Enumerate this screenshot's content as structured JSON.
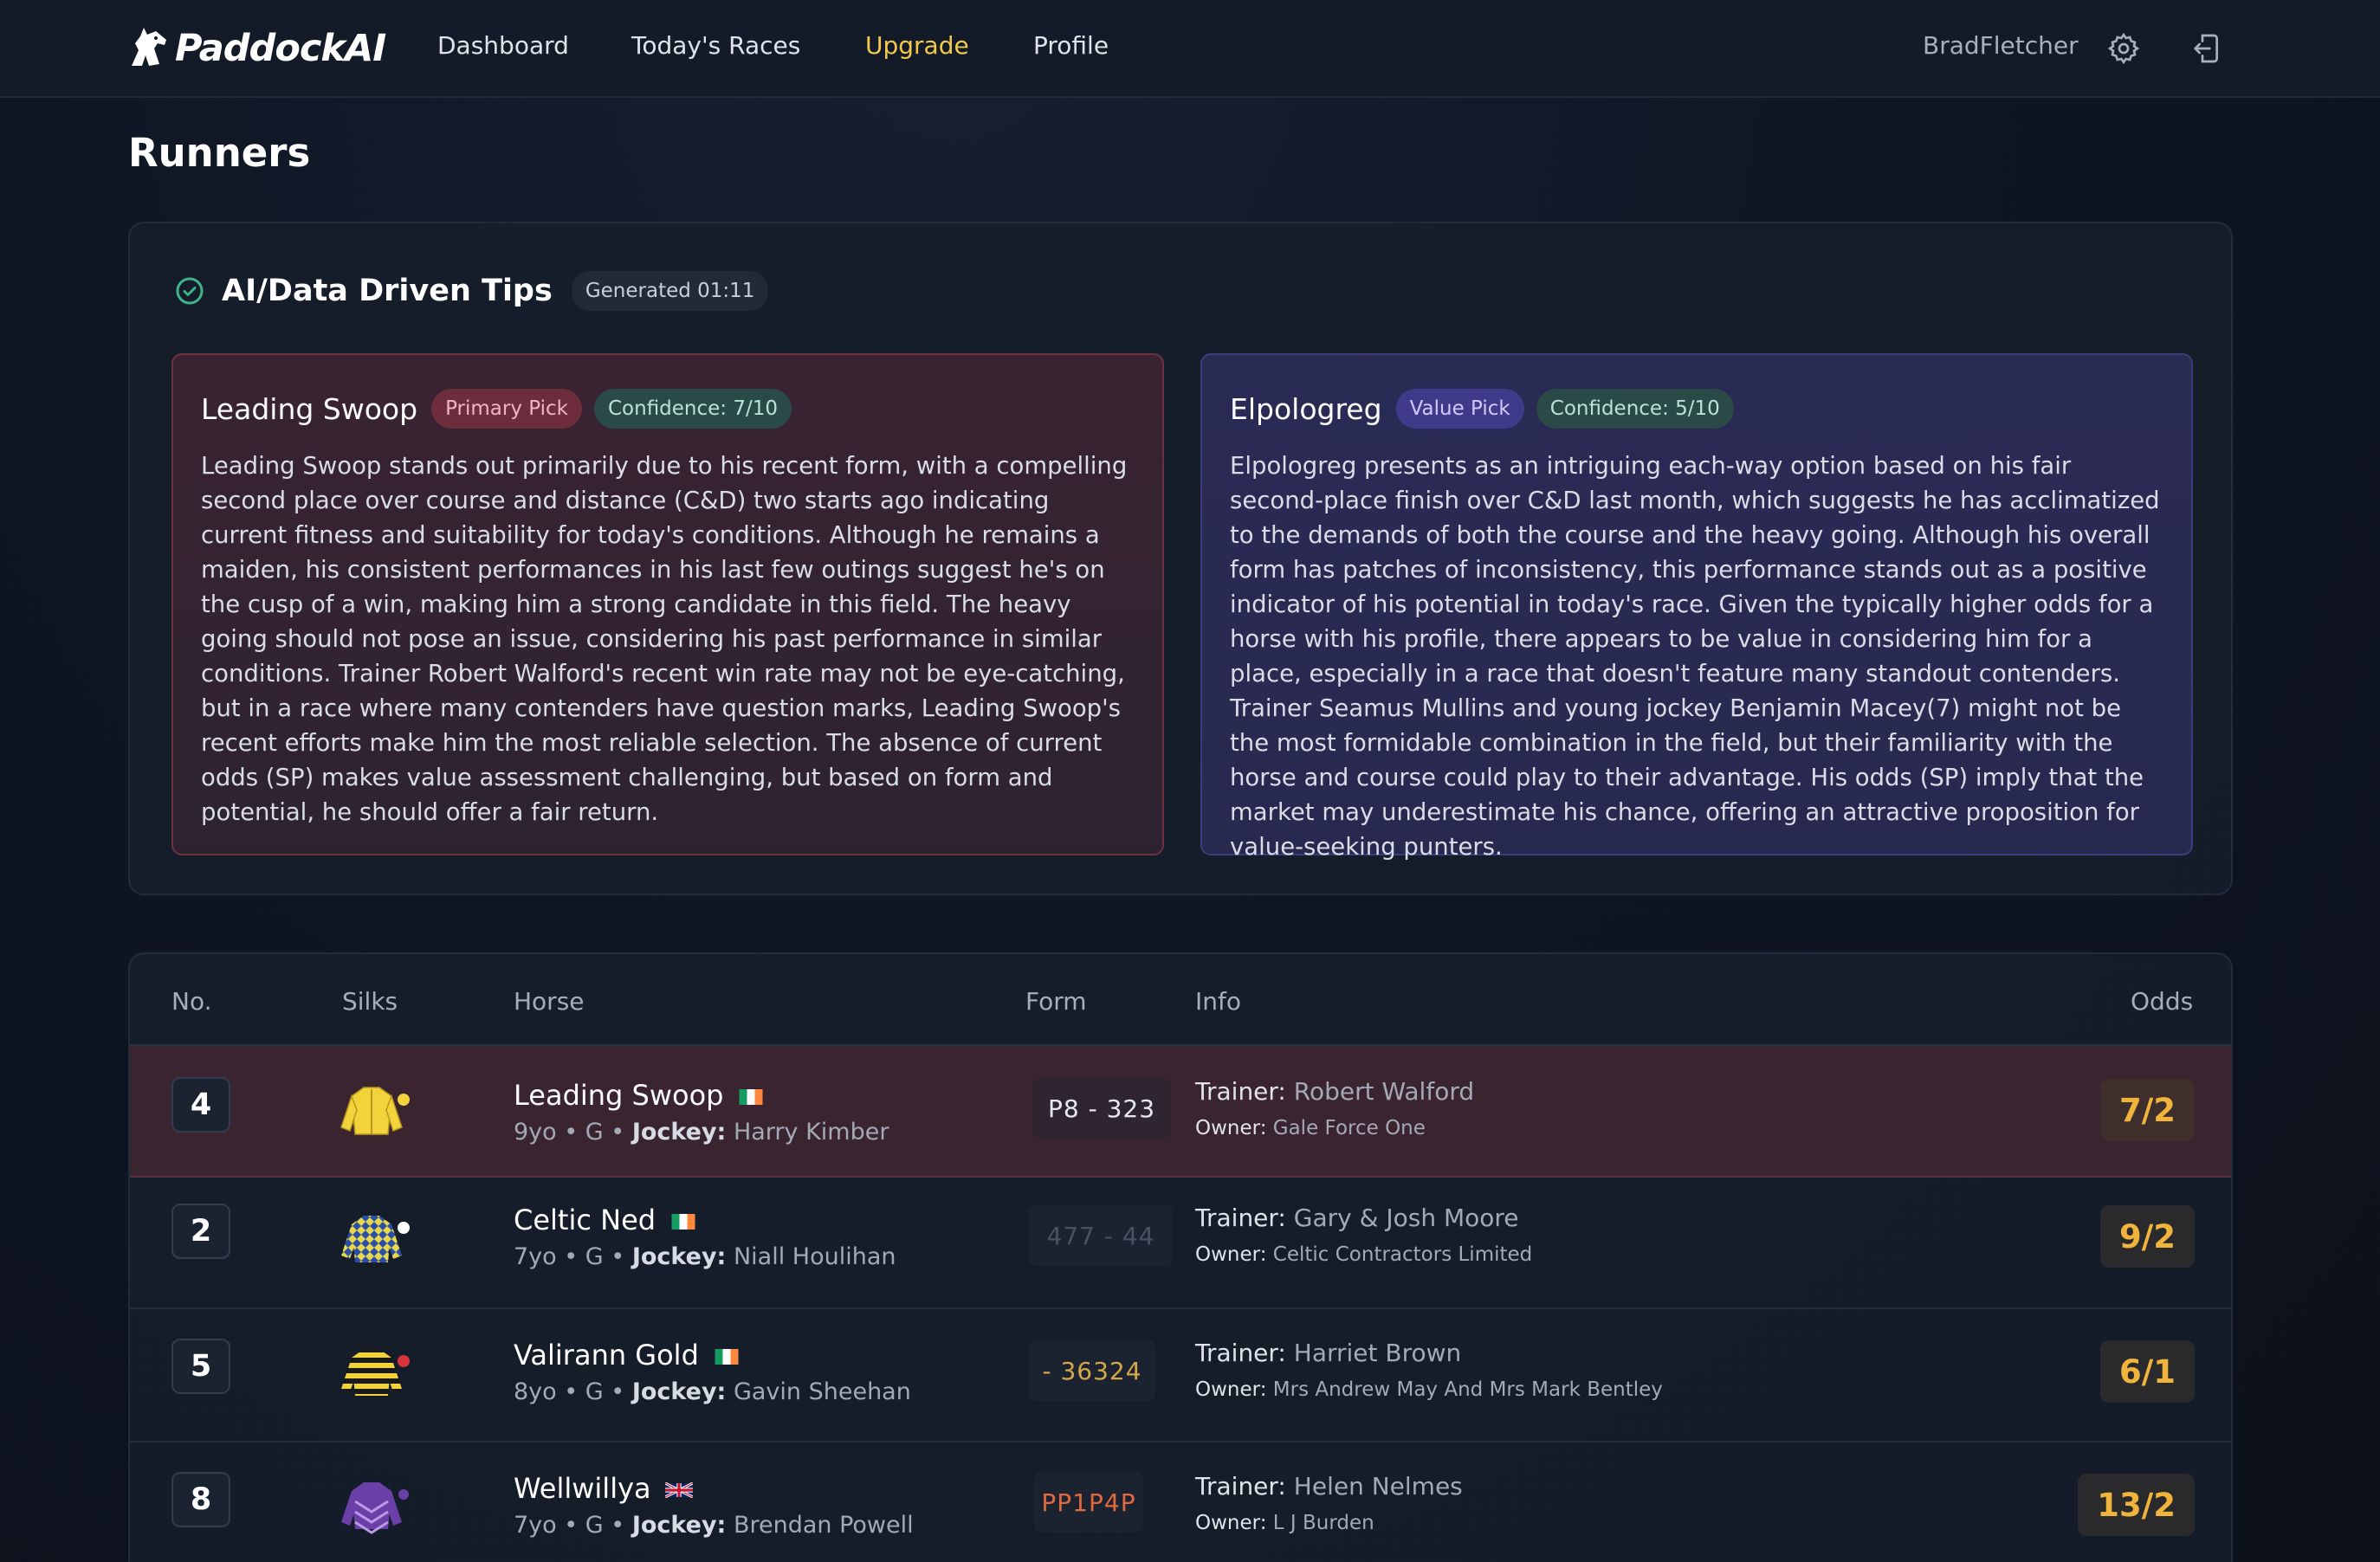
{
  "nav": {
    "brand": "PaddockAI",
    "links": [
      "Dashboard",
      "Today's Races",
      "Upgrade",
      "Profile"
    ],
    "active": "Upgrade",
    "user": "BradFletcher",
    "icons": [
      "settings-gear-icon",
      "logout-icon"
    ]
  },
  "page": {
    "title": "Runners"
  },
  "tips": {
    "title": "AI/Data Driven Tips",
    "generated": "Generated 01:11",
    "cards": [
      {
        "name": "Leading Swoop",
        "tag": "Primary Pick",
        "confidence": "Confidence: 7/10",
        "text": "Leading Swoop stands out primarily due to his recent form, with a compelling second place over course and distance (C&D) two starts ago indicating current fitness and suitability for today's conditions. Although he remains a maiden, his consistent performances in his last few outings suggest he's on the cusp of a win, making him a strong candidate in this field. The heavy going should not pose an issue, considering his past performance in similar conditions. Trainer Robert Walford's recent win rate may not be eye-catching, but in a race where many contenders have question marks, Leading Swoop's recent efforts make him the most reliable selection. The absence of current odds (SP) makes value assessment challenging, but based on form and potential, he should offer a fair return."
      },
      {
        "name": "Elpologreg",
        "tag": "Value Pick",
        "confidence": "Confidence: 5/10",
        "text": "Elpologreg presents as an intriguing each-way option based on his fair second-place finish over C&D last month, which suggests he has acclimatized to the demands of both the course and the heavy going. Although his overall form has patches of inconsistency, this performance stands out as a positive indicator of his potential in today's race. Given the typically higher odds for a horse with his profile, there appears to be value in considering him for a place, especially in a race that doesn't feature many standout contenders. Trainer Seamus Mullins and young jockey Benjamin Macey(7) might not be the most formidable combination in the field, but their familiarity with the horse and course could play to their advantage. His odds (SP) imply that the market may underestimate his chance, offering an attractive proposition for value-seeking punters."
      }
    ]
  },
  "table": {
    "headers": {
      "no": "No.",
      "silks": "Silks",
      "horse": "Horse",
      "form": "Form",
      "info": "Info",
      "odds": "Odds"
    },
    "labels": {
      "jockey": "Jockey:",
      "trainer": "Trainer:",
      "owner": "Owner:"
    },
    "rows": [
      {
        "no": "4",
        "name": "Leading Swoop",
        "flag": "irish-flag-icon",
        "age": "9yo",
        "sex": "G",
        "jockey": "Harry Kimber",
        "form": "P8 - 323",
        "trainer": "Robert Walford",
        "owner": "Gale Force One",
        "odds": "7/2",
        "silk": "yellow-silk-icon",
        "highlight": true
      },
      {
        "no": "2",
        "name": "Celtic Ned",
        "flag": "irish-flag-icon",
        "age": "7yo",
        "sex": "G",
        "jockey": "Niall Houlihan",
        "form": "477 - 44",
        "trainer": "Gary & Josh Moore",
        "owner": "Celtic Contractors Limited",
        "odds": "9/2",
        "silk": "blue-yellow-diamond-silk-icon",
        "highlight": false
      },
      {
        "no": "5",
        "name": "Valirann Gold",
        "flag": "irish-flag-icon",
        "age": "8yo",
        "sex": "G",
        "jockey": "Gavin Sheehan",
        "form": "- 36324",
        "trainer": "Harriet Brown",
        "owner": "Mrs Andrew May And Mrs Mark Bentley",
        "odds": "6/1",
        "silk": "black-yellow-hoops-silk-icon",
        "highlight": false
      },
      {
        "no": "8",
        "name": "Wellwillya",
        "flag": "uk-flag-icon",
        "age": "7yo",
        "sex": "G",
        "jockey": "Brendan Powell",
        "form": "PP1P4P",
        "trainer": "Helen Nelmes",
        "owner": "L J Burden",
        "odds": "13/2",
        "silk": "purple-chevron-silk-icon",
        "highlight": false
      }
    ]
  }
}
